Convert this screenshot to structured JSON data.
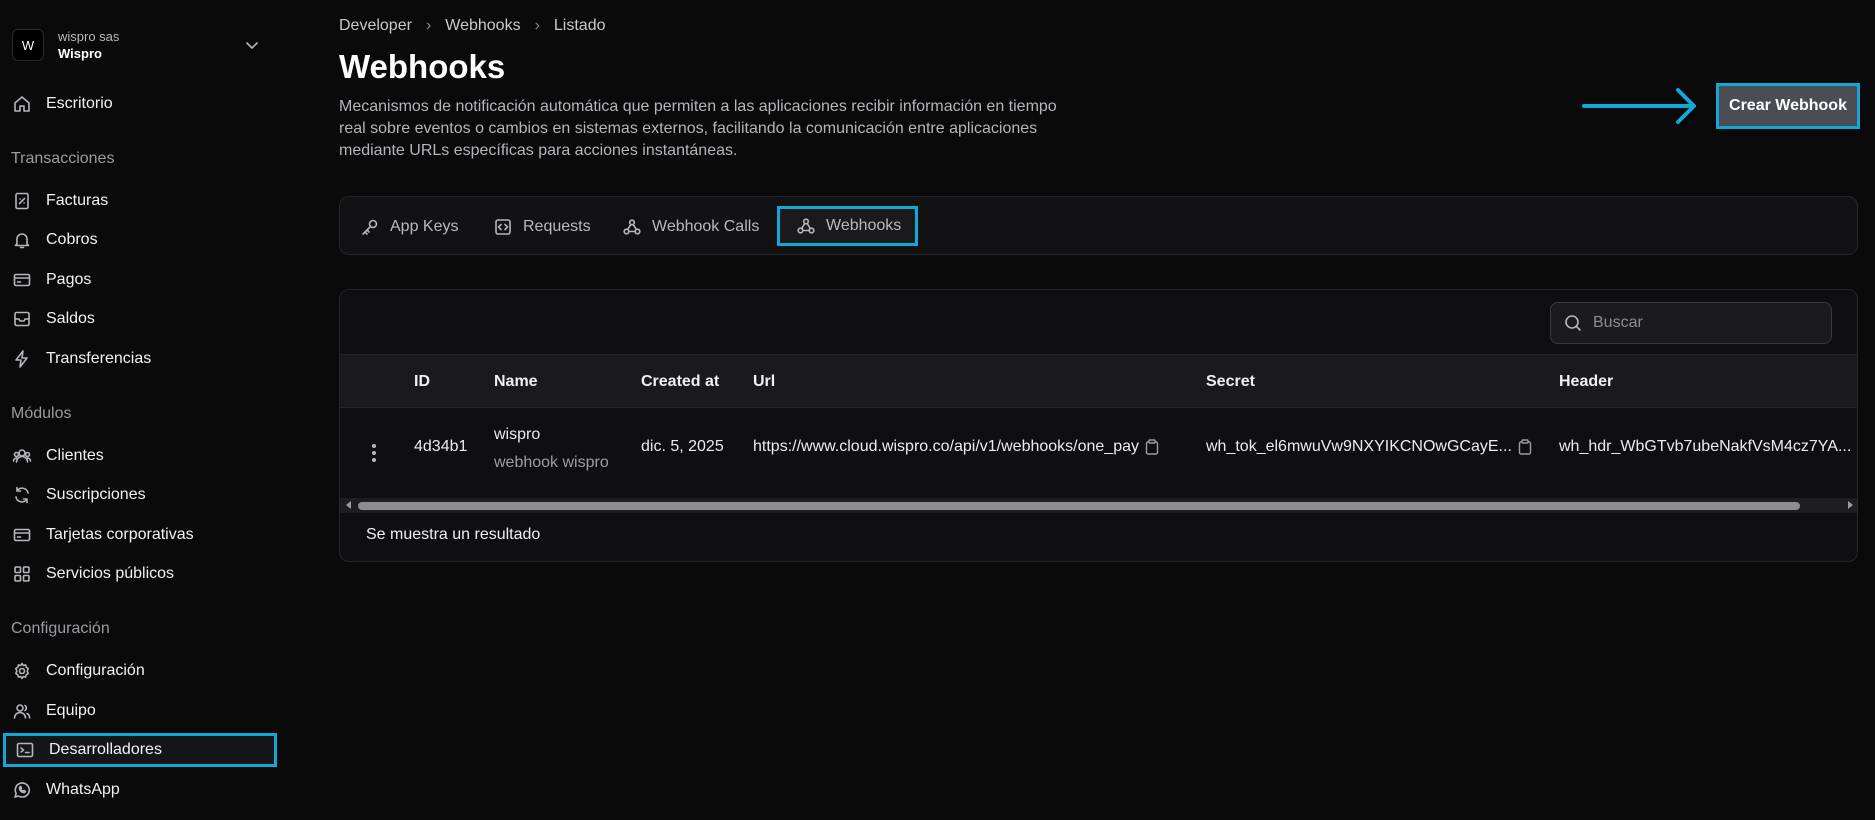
{
  "org": {
    "avatar_letter": "W",
    "subtitle": "wispro sas",
    "name": "Wispro"
  },
  "sidebar": {
    "home": {
      "label": "Escritorio",
      "icon": "home-icon"
    },
    "sections": [
      {
        "title": "Transacciones",
        "items": [
          {
            "label": "Facturas",
            "icon": "invoice-icon"
          },
          {
            "label": "Cobros",
            "icon": "bell-icon"
          },
          {
            "label": "Pagos",
            "icon": "card-icon"
          },
          {
            "label": "Saldos",
            "icon": "inbox-icon"
          },
          {
            "label": "Transferencias",
            "icon": "bolt-icon"
          }
        ]
      },
      {
        "title": "Módulos",
        "items": [
          {
            "label": "Clientes",
            "icon": "users-icon"
          },
          {
            "label": "Suscripciones",
            "icon": "refresh-icon"
          },
          {
            "label": "Tarjetas corporativas",
            "icon": "card-icon"
          },
          {
            "label": "Servicios públicos",
            "icon": "grid-icon"
          }
        ]
      },
      {
        "title": "Configuración",
        "items": [
          {
            "label": "Configuración",
            "icon": "gear-icon"
          },
          {
            "label": "Equipo",
            "icon": "team-icon"
          },
          {
            "label": "Desarrolladores",
            "icon": "terminal-icon",
            "active": true
          },
          {
            "label": "WhatsApp",
            "icon": "whatsapp-icon"
          }
        ]
      }
    ]
  },
  "breadcrumb": [
    "Developer",
    "Webhooks",
    "Listado"
  ],
  "page": {
    "title": "Webhooks",
    "description": "Mecanismos de notificación automática que permiten a las aplicaciones recibir información en tiempo real sobre eventos o cambios en sistemas externos, facilitando la comunicación entre aplicaciones mediante URLs específicas para acciones instantáneas.",
    "create_button": "Crear Webhook"
  },
  "tabs": [
    {
      "label": "App Keys",
      "icon": "key-icon"
    },
    {
      "label": "Requests",
      "icon": "code-icon"
    },
    {
      "label": "Webhook Calls",
      "icon": "webhook-icon"
    },
    {
      "label": "Webhooks",
      "icon": "webhook-icon",
      "active": true
    }
  ],
  "search": {
    "placeholder": "Buscar"
  },
  "table": {
    "columns": [
      "ID",
      "Name",
      "Created at",
      "Url",
      "Secret",
      "Header"
    ],
    "rows": [
      {
        "id": "4d34b1",
        "name": "wispro",
        "description": "webhook wispro",
        "created_at": "dic. 5, 2025",
        "url": "https://www.cloud.wispro.co/api/v1/webhooks/one_pay",
        "secret": "wh_tok_el6mwuVw9NXYIKCNOwGCayE...",
        "header": "wh_hdr_WbGTvb7ubeNakfVsM4cz7YA..."
      }
    ],
    "footer": "Se muestra un resultado"
  },
  "colors": {
    "highlight": "#12a7d6",
    "background": "#0a0a0b",
    "button": "#4b4d55"
  }
}
